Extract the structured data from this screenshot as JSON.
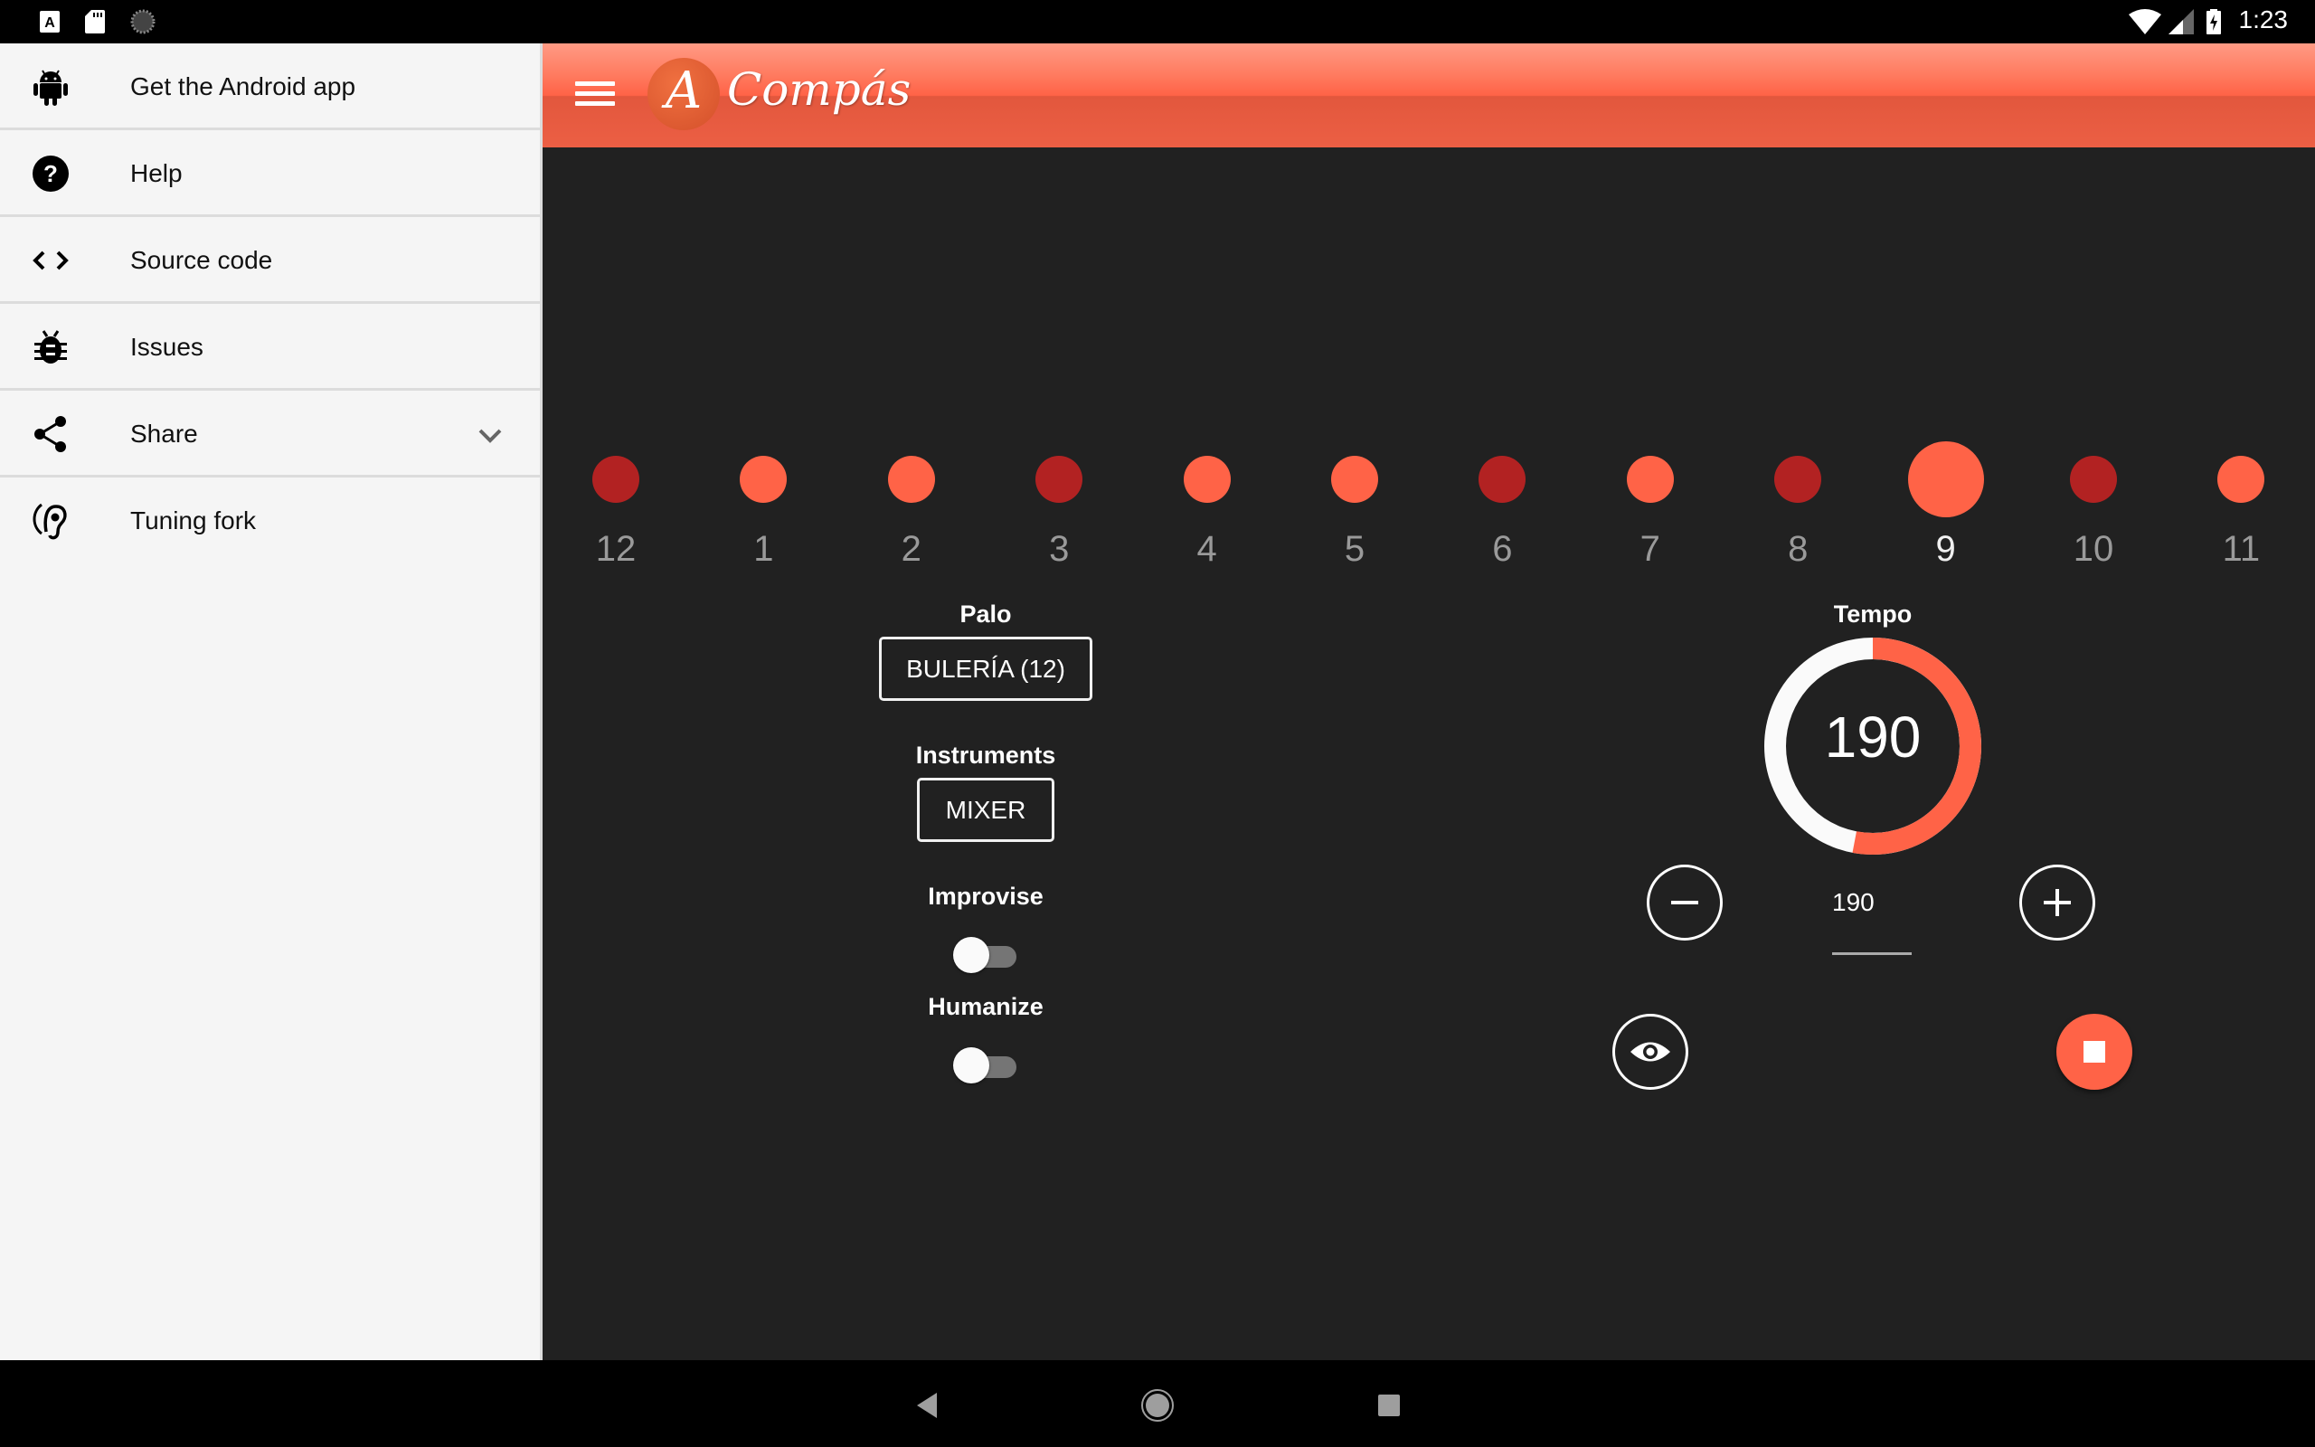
{
  "status_bar": {
    "time": "1:23",
    "left_icons": [
      "text-a-icon",
      "sd-card-icon",
      "loading-icon"
    ],
    "right_icons": [
      "wifi-icon",
      "cell-signal-icon",
      "battery-charging-icon"
    ]
  },
  "header": {
    "menu_icon": "hamburger-menu-icon",
    "logo_letter": "A",
    "app_title": "Compás",
    "color": "#ff6347"
  },
  "drawer": {
    "items": [
      {
        "label": "Get the Android app",
        "icon": "android-icon"
      },
      {
        "label": "Help",
        "icon": "help-circle-icon"
      },
      {
        "label": "Source code",
        "icon": "code-icon"
      },
      {
        "label": "Issues",
        "icon": "bug-icon"
      },
      {
        "label": "Share",
        "icon": "share-icon",
        "expand_icon": "chevron-down-icon"
      },
      {
        "label": "Tuning fork",
        "icon": "hearing-icon"
      }
    ]
  },
  "beats": {
    "active_beat": "9",
    "accent_color": "#b22222",
    "normal_color": "#ff6347",
    "items": [
      {
        "label": "12",
        "accent": true
      },
      {
        "label": "1",
        "accent": false
      },
      {
        "label": "2",
        "accent": false
      },
      {
        "label": "3",
        "accent": true
      },
      {
        "label": "4",
        "accent": false
      },
      {
        "label": "5",
        "accent": false
      },
      {
        "label": "6",
        "accent": true
      },
      {
        "label": "7",
        "accent": false
      },
      {
        "label": "8",
        "accent": true
      },
      {
        "label": "9",
        "accent": false,
        "active": true
      },
      {
        "label": "10",
        "accent": true
      },
      {
        "label": "11",
        "accent": false
      }
    ]
  },
  "controls": {
    "palo_label": "Palo",
    "palo_value": "BULERÍA (12)",
    "instruments_label": "Instruments",
    "instruments_value": "MIXER",
    "improvise_label": "Improvise",
    "improvise_on": false,
    "humanize_label": "Humanize",
    "humanize_on": false
  },
  "tempo": {
    "label": "Tempo",
    "value": "190",
    "input_value": "190",
    "dial_fraction": 0.53,
    "decrease_icon": "minus-icon",
    "increase_icon": "plus-icon",
    "visibility_icon": "eye-icon",
    "stop_icon": "stop-icon"
  },
  "nav_bar": {
    "buttons": [
      "back-icon",
      "home-icon",
      "recents-icon"
    ]
  }
}
